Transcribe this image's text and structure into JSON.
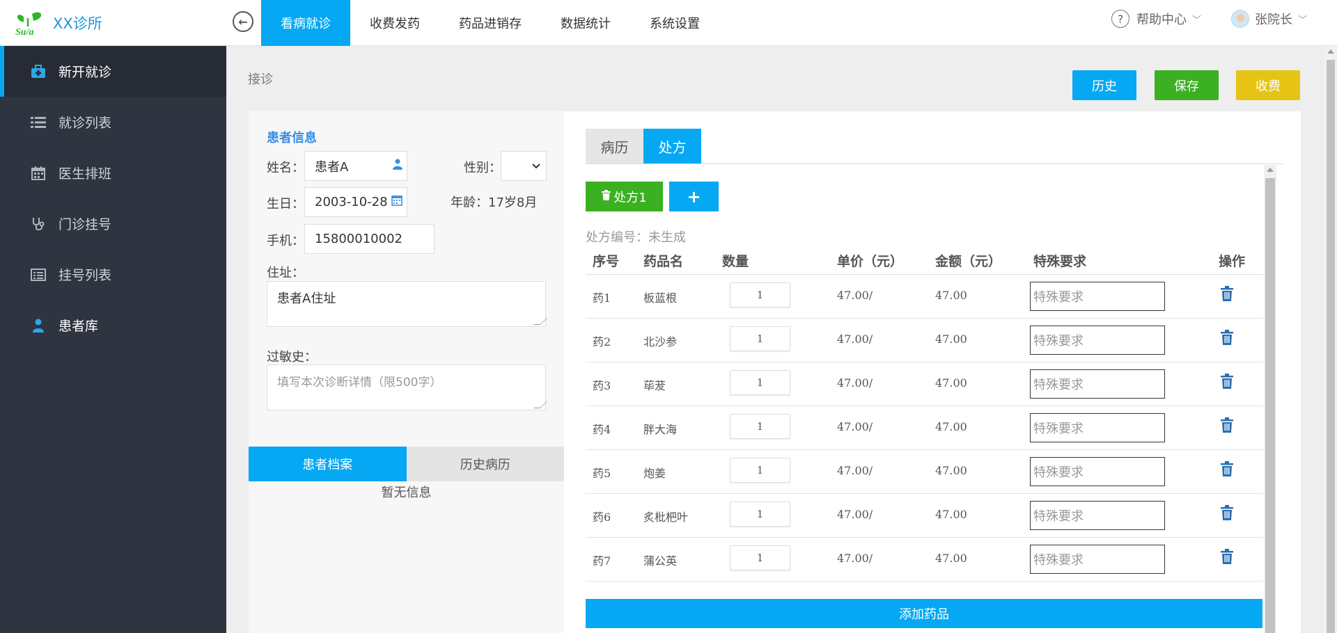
{
  "header": {
    "logo_text": "Su/a",
    "brand": "XX诊所",
    "nav": [
      {
        "label": "看病就诊",
        "active": true
      },
      {
        "label": "收费发药",
        "active": false
      },
      {
        "label": "药品进销存",
        "active": false
      },
      {
        "label": "数据统计",
        "active": false
      },
      {
        "label": "系统设置",
        "active": false
      }
    ],
    "help_label": "帮助中心",
    "user_name": "张院长"
  },
  "sidebar": {
    "items": [
      {
        "label": "新开就诊",
        "icon": "medical-kit-icon"
      },
      {
        "label": "就诊列表",
        "icon": "list-icon"
      },
      {
        "label": "医生排班",
        "icon": "calendar-icon"
      },
      {
        "label": "门诊挂号",
        "icon": "stethoscope-icon"
      },
      {
        "label": "挂号列表",
        "icon": "register-list-icon"
      },
      {
        "label": "患者库",
        "icon": "user-icon"
      }
    ]
  },
  "page": {
    "breadcrumb": "接诊",
    "buttons": {
      "history": "历史",
      "save": "保存",
      "charge": "收费"
    }
  },
  "patient": {
    "section_title": "患者信息",
    "name_label": "姓名：",
    "name_value": "患者A",
    "gender_label": "性别：",
    "gender_value": "",
    "birth_label": "生日：",
    "birth_value": "2003-10-28",
    "age_label": "年龄：",
    "age_value": "17岁8月",
    "phone_label": "手机：",
    "phone_value": "15800010002",
    "address_label": "住址：",
    "address_value": "患者A住址",
    "allergy_label": "过敏史：",
    "allergy_placeholder": "填写本次诊断详情（限500字）",
    "tabs": [
      "患者档案",
      "历史病历"
    ],
    "no_info": "暂无信息"
  },
  "prescription": {
    "tabs": [
      "病历",
      "处方"
    ],
    "active_tab": "处方",
    "presc_button": "处方1",
    "presc_no": "处方编号：未生成",
    "headers": [
      "序号",
      "药品名",
      "数量",
      "单价（元）",
      "金额（元）",
      "特殊要求",
      "操作"
    ],
    "rows": [
      {
        "no": "药1",
        "name": "板蓝根",
        "qty": "1",
        "price": "47.00/",
        "amount": "47.00"
      },
      {
        "no": "药2",
        "name": "北沙参",
        "qty": "1",
        "price": "47.00/",
        "amount": "47.00"
      },
      {
        "no": "药3",
        "name": "荜茇",
        "qty": "1",
        "price": "47.00/",
        "amount": "47.00"
      },
      {
        "no": "药4",
        "name": "胖大海",
        "qty": "1",
        "price": "47.00/",
        "amount": "47.00"
      },
      {
        "no": "药5",
        "name": "炮姜",
        "qty": "1",
        "price": "47.00/",
        "amount": "47.00"
      },
      {
        "no": "药6",
        "name": "炙枇杷叶",
        "qty": "1",
        "price": "47.00/",
        "amount": "47.00"
      },
      {
        "no": "药7",
        "name": "蒲公英",
        "qty": "1",
        "price": "47.00/",
        "amount": "47.00"
      }
    ],
    "req_placeholder": "特殊要求",
    "add_drug": "添加药品"
  },
  "colors": {
    "primary": "#06a8f3",
    "success": "#3bb021",
    "warning": "#e6c415",
    "sidebar": "#2e3440"
  }
}
